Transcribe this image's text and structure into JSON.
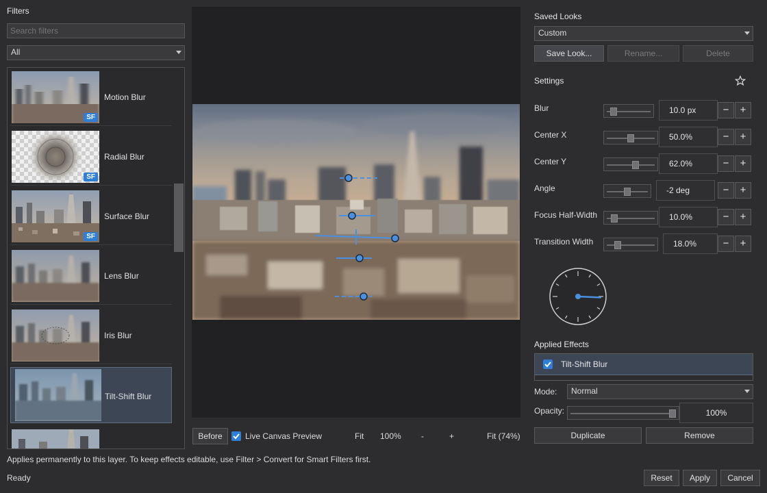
{
  "left": {
    "title": "Filters",
    "search_placeholder": "Search filters",
    "category": "All",
    "items": [
      {
        "label": "Motion Blur",
        "badge": "SF"
      },
      {
        "label": "Radial Blur",
        "badge": "SF"
      },
      {
        "label": "Surface Blur",
        "badge": "SF"
      },
      {
        "label": "Lens Blur",
        "badge": ""
      },
      {
        "label": "Iris Blur",
        "badge": ""
      },
      {
        "label": "Tilt-Shift Blur",
        "badge": "",
        "selected": true
      }
    ]
  },
  "center": {
    "before_label": "Before",
    "live_preview_label": "Live Canvas Preview",
    "live_preview_checked": true,
    "zoom": {
      "fit": "Fit",
      "pct": "100%",
      "minus": "-",
      "plus": "+",
      "fit_pct": "Fit (74%)"
    }
  },
  "right": {
    "saved_looks_title": "Saved Looks",
    "saved_looks_value": "Custom",
    "save_look": "Save Look...",
    "rename": "Rename...",
    "delete": "Delete",
    "settings_title": "Settings",
    "settings": [
      {
        "label": "Blur",
        "value": "10.0 px",
        "level": 0.1
      },
      {
        "label": "Center X",
        "value": "50.0%",
        "level": 0.5
      },
      {
        "label": "Center Y",
        "value": "62.0%",
        "level": 0.62
      },
      {
        "label": "Angle",
        "value": "-2 deg",
        "level": 0.49
      },
      {
        "label": "Focus Half-Width",
        "value": "10.0%",
        "level": 0.1
      },
      {
        "label": "Transition Width",
        "value": "18.0%",
        "level": 0.18
      }
    ],
    "applied_title": "Applied Effects",
    "effect_name": "Tilt-Shift Blur",
    "mode_label": "Mode:",
    "mode_value": "Normal",
    "opacity_label": "Opacity:",
    "opacity_value": "100%",
    "opacity_level": 1.0,
    "duplicate": "Duplicate",
    "remove": "Remove"
  },
  "footer": {
    "hint": "Applies permanently to this layer. To keep effects editable, use Filter > Convert for Smart Filters first.",
    "status": "Ready",
    "reset": "Reset",
    "apply": "Apply",
    "cancel": "Cancel"
  },
  "colors": {
    "accent": "#2f7fd6",
    "selection": "#3d4654",
    "handle_fill": "#4a90e2"
  },
  "icons": {
    "favorite": "star-icon",
    "checkbox": "checkmark-icon",
    "dropdown": "chevron-down-icon"
  }
}
